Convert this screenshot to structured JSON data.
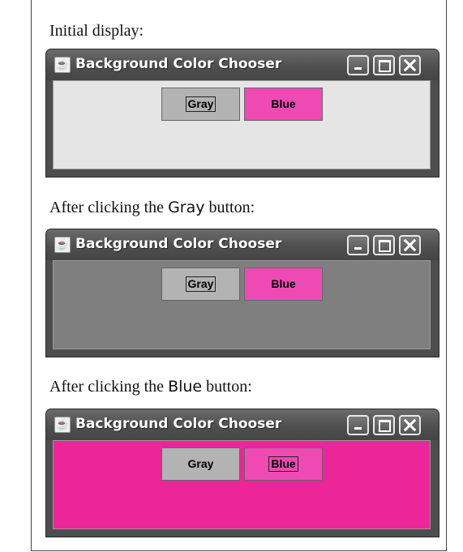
{
  "captions": {
    "initial": "Initial display:",
    "after_gray_prefix": "After clicking the ",
    "after_gray_code": "Gray",
    "after_gray_suffix": " button:",
    "after_blue_prefix": "After clicking the ",
    "after_blue_code": "Blue",
    "after_blue_suffix": " button:"
  },
  "windows": [
    {
      "title": "Background Color Chooser",
      "background_color": "#e5e5e5",
      "gray_label": "Gray",
      "blue_label": "Blue",
      "focused_button": "Gray"
    },
    {
      "title": "Background Color Chooser",
      "background_color": "#7f7f7f",
      "gray_label": "Gray",
      "blue_label": "Blue",
      "focused_button": "Gray"
    },
    {
      "title": "Background Color Chooser",
      "background_color": "#ec2699",
      "gray_label": "Gray",
      "blue_label": "Blue",
      "focused_button": "Blue"
    }
  ],
  "colors": {
    "gray_button": "#b3b3b3",
    "blue_button": "#ef4ab3"
  },
  "icons": [
    "java-app-icon",
    "minimize-icon",
    "maximize-icon",
    "close-icon"
  ]
}
